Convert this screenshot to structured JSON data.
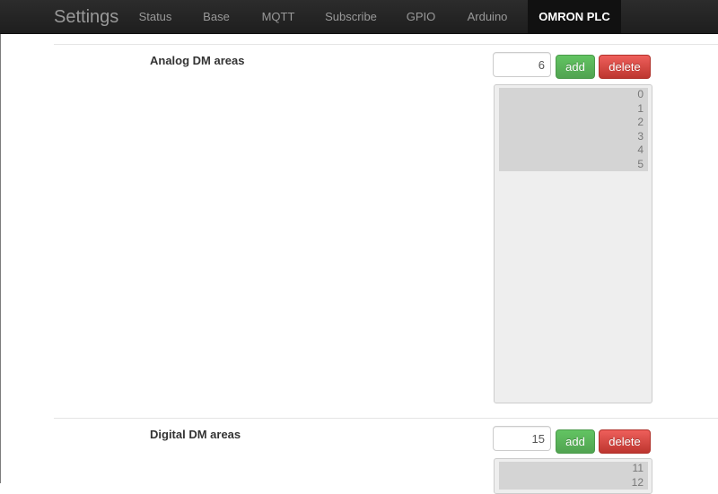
{
  "navbar": {
    "brand": "Settings",
    "items": [
      {
        "label": "Status"
      },
      {
        "label": "Base"
      },
      {
        "label": "MQTT"
      },
      {
        "label": "Subscribe"
      },
      {
        "label": "GPIO"
      },
      {
        "label": "Arduino"
      },
      {
        "label": "OMRON PLC",
        "active": true
      }
    ]
  },
  "analog": {
    "label": "Analog DM areas",
    "input_value": "6",
    "add_label": "add",
    "delete_label": "delete",
    "items": [
      "0",
      "1",
      "2",
      "3",
      "4",
      "5"
    ]
  },
  "digital": {
    "label": "Digital DM areas",
    "input_value": "15",
    "add_label": "add",
    "delete_label": "delete",
    "items": [
      "11",
      "12"
    ]
  },
  "colors": {
    "navbar_bg": "#1e1e1e",
    "active_tab_bg": "#111111",
    "add_button": "#51a351",
    "delete_button": "#bd362f"
  }
}
